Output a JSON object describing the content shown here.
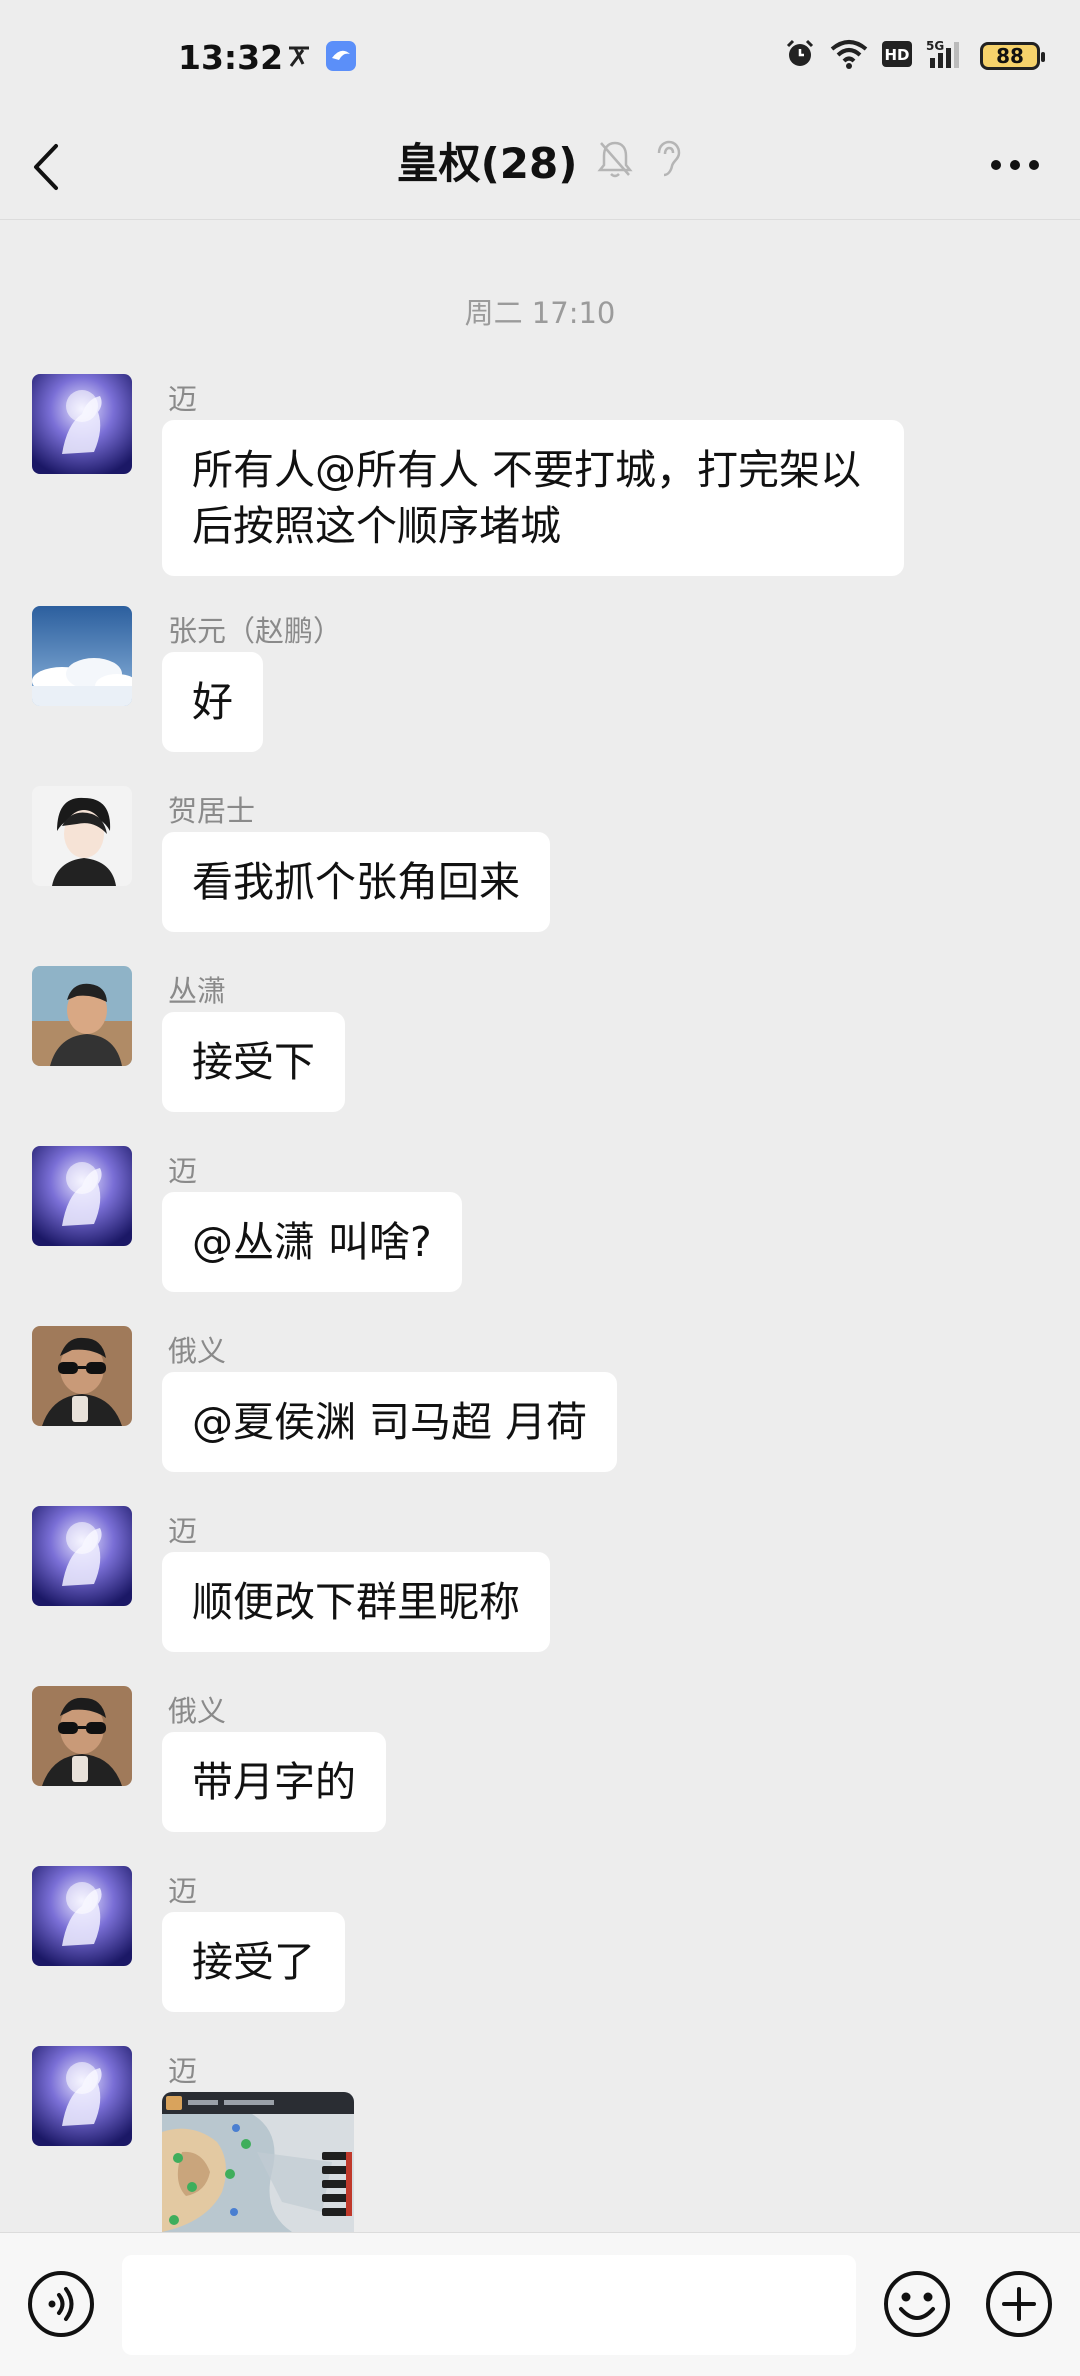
{
  "status_bar": {
    "time": "13:32",
    "battery": "88",
    "network": "5G",
    "hd_label": "HD"
  },
  "nav": {
    "title": "皇权(28)"
  },
  "chat": {
    "timestamp": "周二 17:10",
    "messages": [
      {
        "sender": "迈",
        "text": "所有人@所有人  不要打城，打完架以后按照这个顺序堵城",
        "avatar": "galaxy-horse"
      },
      {
        "sender": "张元（赵鹏）",
        "text": "好",
        "avatar": "sky-clouds"
      },
      {
        "sender": "贺居士",
        "text": "看我抓个张角回来",
        "avatar": "anime-boy"
      },
      {
        "sender": "丛潇",
        "text": "接受下",
        "avatar": "man-photo"
      },
      {
        "sender": "迈",
        "text": "@丛潇  叫啥?",
        "avatar": "galaxy-horse"
      },
      {
        "sender": "俄义",
        "text": "@夏侯渊  司马超  月荷",
        "avatar": "sunglasses-man"
      },
      {
        "sender": "迈",
        "text": "顺便改下群里昵称",
        "avatar": "galaxy-horse"
      },
      {
        "sender": "俄义",
        "text": "带月字的",
        "avatar": "sunglasses-man"
      },
      {
        "sender": "迈",
        "text": "接受了",
        "avatar": "galaxy-horse"
      },
      {
        "sender": "迈",
        "text": "",
        "avatar": "galaxy-horse",
        "image": "game-map-screenshot"
      }
    ]
  },
  "input_bar": {
    "placeholder": ""
  },
  "colors": {
    "background": "#ededed",
    "bubble": "#ffffff",
    "secondary_text": "#8a8a8a"
  }
}
